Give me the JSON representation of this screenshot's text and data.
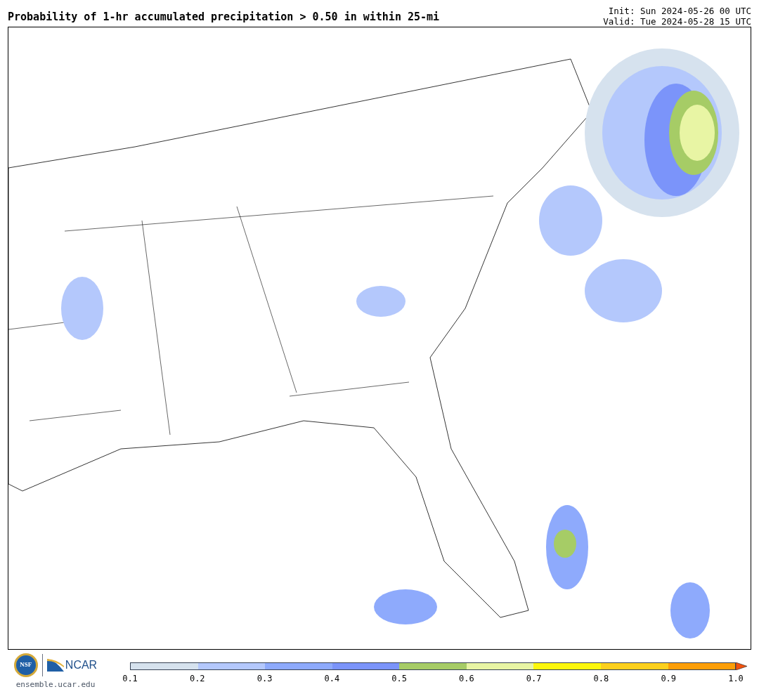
{
  "title": "Probability of 1-hr accumulated precipitation > 0.50 in within 25-mi",
  "init": "Init: Sun 2024-05-26 00 UTC",
  "valid": "Valid: Tue 2024-05-28 15 UTC",
  "logos": {
    "nsf": "NSF",
    "ncar": "NCAR",
    "url": "ensemble.ucar.edu"
  },
  "colorbar": {
    "bins": [
      {
        "kind": "bin",
        "color": "#d6e2ee"
      },
      {
        "kind": "bin",
        "color": "#b4c8fc"
      },
      {
        "kind": "bin",
        "color": "#8eaafc"
      },
      {
        "kind": "bin",
        "color": "#7b94fa"
      },
      {
        "kind": "bin",
        "color": "#a6cc66"
      },
      {
        "kind": "bin",
        "color": "#e8f5a4"
      },
      {
        "kind": "bin",
        "color": "#fcf70c"
      },
      {
        "kind": "bin",
        "color": "#fcd01c"
      },
      {
        "kind": "bin",
        "color": "#fc9e08"
      },
      {
        "kind": "arrow",
        "color": "#f4520c"
      }
    ],
    "ticks": [
      "0.1",
      "0.2",
      "0.3",
      "0.4",
      "0.5",
      "0.6",
      "0.7",
      "0.8",
      "0.9",
      "1.0"
    ]
  }
}
